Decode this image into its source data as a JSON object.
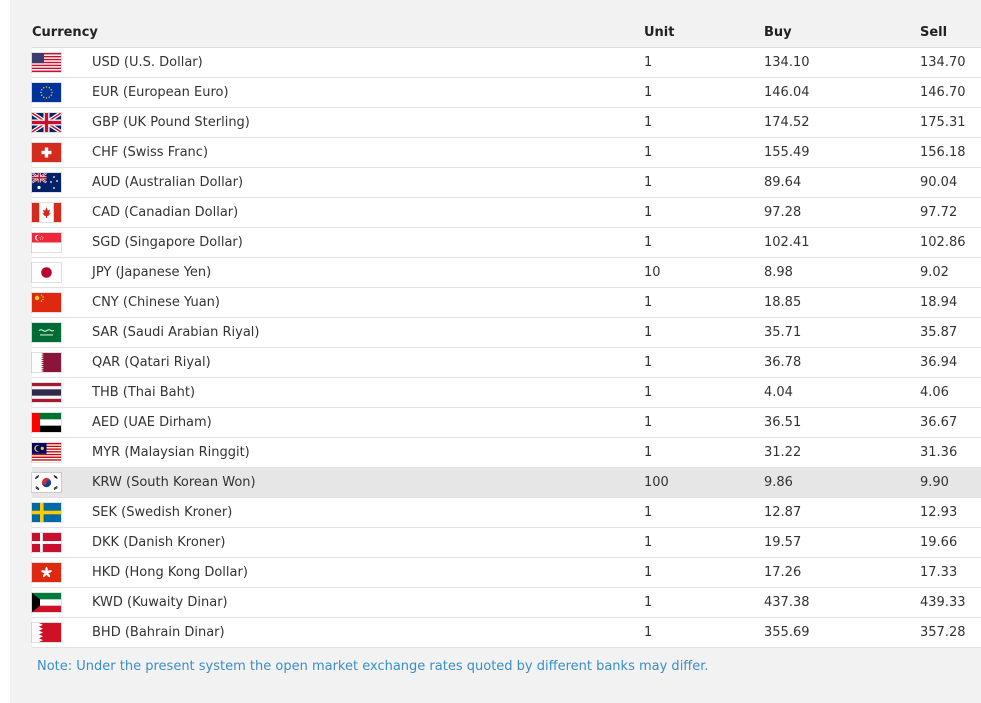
{
  "table": {
    "headers": {
      "currency": "Currency",
      "unit": "Unit",
      "buy": "Buy",
      "sell": "Sell"
    },
    "rows": [
      {
        "flag": "us-flag-icon",
        "name": "USD (U.S. Dollar)",
        "unit": "1",
        "buy": "134.10",
        "sell": "134.70"
      },
      {
        "flag": "eu-flag-icon",
        "name": "EUR (European Euro)",
        "unit": "1",
        "buy": "146.04",
        "sell": "146.70"
      },
      {
        "flag": "uk-flag-icon",
        "name": "GBP (UK Pound Sterling)",
        "unit": "1",
        "buy": "174.52",
        "sell": "175.31"
      },
      {
        "flag": "ch-flag-icon",
        "name": "CHF (Swiss Franc)",
        "unit": "1",
        "buy": "155.49",
        "sell": "156.18"
      },
      {
        "flag": "au-flag-icon",
        "name": "AUD (Australian Dollar)",
        "unit": "1",
        "buy": "89.64",
        "sell": "90.04"
      },
      {
        "flag": "ca-flag-icon",
        "name": "CAD (Canadian Dollar)",
        "unit": "1",
        "buy": "97.28",
        "sell": "97.72"
      },
      {
        "flag": "sg-flag-icon",
        "name": "SGD (Singapore Dollar)",
        "unit": "1",
        "buy": "102.41",
        "sell": "102.86"
      },
      {
        "flag": "jp-flag-icon",
        "name": "JPY (Japanese Yen)",
        "unit": "10",
        "buy": "8.98",
        "sell": "9.02"
      },
      {
        "flag": "cn-flag-icon",
        "name": "CNY (Chinese Yuan)",
        "unit": "1",
        "buy": "18.85",
        "sell": "18.94"
      },
      {
        "flag": "sa-flag-icon",
        "name": "SAR (Saudi Arabian Riyal)",
        "unit": "1",
        "buy": "35.71",
        "sell": "35.87"
      },
      {
        "flag": "qa-flag-icon",
        "name": "QAR (Qatari Riyal)",
        "unit": "1",
        "buy": "36.78",
        "sell": "36.94"
      },
      {
        "flag": "th-flag-icon",
        "name": "THB (Thai Baht)",
        "unit": "1",
        "buy": "4.04",
        "sell": "4.06"
      },
      {
        "flag": "ae-flag-icon",
        "name": "AED (UAE Dirham)",
        "unit": "1",
        "buy": "36.51",
        "sell": "36.67"
      },
      {
        "flag": "my-flag-icon",
        "name": "MYR (Malaysian Ringgit)",
        "unit": "1",
        "buy": "31.22",
        "sell": "31.36"
      },
      {
        "flag": "kr-flag-icon",
        "name": "KRW (South Korean Won)",
        "unit": "100",
        "buy": "9.86",
        "sell": "9.90"
      },
      {
        "flag": "se-flag-icon",
        "name": "SEK (Swedish Kroner)",
        "unit": "1",
        "buy": "12.87",
        "sell": "12.93"
      },
      {
        "flag": "dk-flag-icon",
        "name": "DKK (Danish Kroner)",
        "unit": "1",
        "buy": "19.57",
        "sell": "19.66"
      },
      {
        "flag": "hk-flag-icon",
        "name": "HKD (Hong Kong Dollar)",
        "unit": "1",
        "buy": "17.26",
        "sell": "17.33"
      },
      {
        "flag": "kw-flag-icon",
        "name": "KWD (Kuwaity Dinar)",
        "unit": "1",
        "buy": "437.38",
        "sell": "439.33"
      },
      {
        "flag": "bh-flag-icon",
        "name": "BHD (Bahrain Dinar)",
        "unit": "1",
        "buy": "355.69",
        "sell": "357.28"
      }
    ]
  },
  "note": "Note: Under the present system the open market exchange rates quoted by different banks may differ.",
  "colors": {
    "note": "#3a8fc6",
    "highlight_row": "#e6e6e6",
    "panel": "#f2f2f2"
  }
}
